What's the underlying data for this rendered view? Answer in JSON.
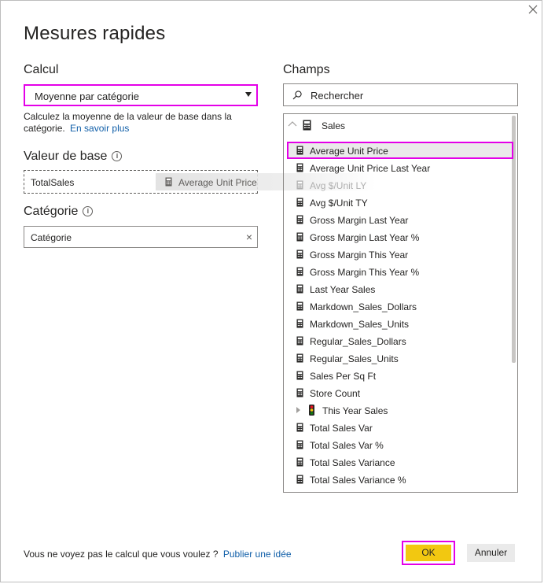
{
  "dialog": {
    "title": "Mesures rapides",
    "calc": {
      "label": "Calcul",
      "selected": "Moyenne par catégorie",
      "description": "Calculez la moyenne de la valeur de base dans la catégorie.",
      "learn_more": "En savoir plus"
    },
    "base_value": {
      "label": "Valeur de base",
      "info": "i",
      "value": "TotalSales",
      "drag_ghost": "Average Unit Price"
    },
    "category": {
      "label": "Catégorie",
      "info": "i",
      "value": "Catégorie",
      "clear": "×"
    },
    "fields": {
      "label": "Champs",
      "search_placeholder": "Rechercher",
      "table_name": "Sales",
      "items": [
        {
          "label": "Average Unit Price"
        },
        {
          "label": "Average Unit Price Last Year"
        },
        {
          "label": "Avg $/Unit LY"
        },
        {
          "label": "Avg $/Unit TY"
        },
        {
          "label": "Gross Margin Last Year"
        },
        {
          "label": "Gross Margin Last Year %"
        },
        {
          "label": "Gross Margin This Year"
        },
        {
          "label": "Gross Margin This Year %"
        },
        {
          "label": "Last Year Sales"
        },
        {
          "label": "Markdown_Sales_Dollars"
        },
        {
          "label": "Markdown_Sales_Units"
        },
        {
          "label": "Regular_Sales_Dollars"
        },
        {
          "label": "Regular_Sales_Units"
        },
        {
          "label": "Sales Per Sq Ft"
        },
        {
          "label": "Store Count"
        },
        {
          "label": "This Year Sales"
        },
        {
          "label": "Total Sales Var"
        },
        {
          "label": "Total Sales Var %"
        },
        {
          "label": "Total Sales Variance"
        },
        {
          "label": "Total Sales Variance %"
        }
      ]
    },
    "footer": {
      "question": "Vous ne voyez pas le calcul que vous voulez ?",
      "link": "Publier une idée",
      "ok": "OK",
      "cancel": "Annuler"
    },
    "colors": {
      "highlight_border": "#e400e8",
      "ok_fill": "#f2c811",
      "link": "#0f5ea8"
    }
  }
}
